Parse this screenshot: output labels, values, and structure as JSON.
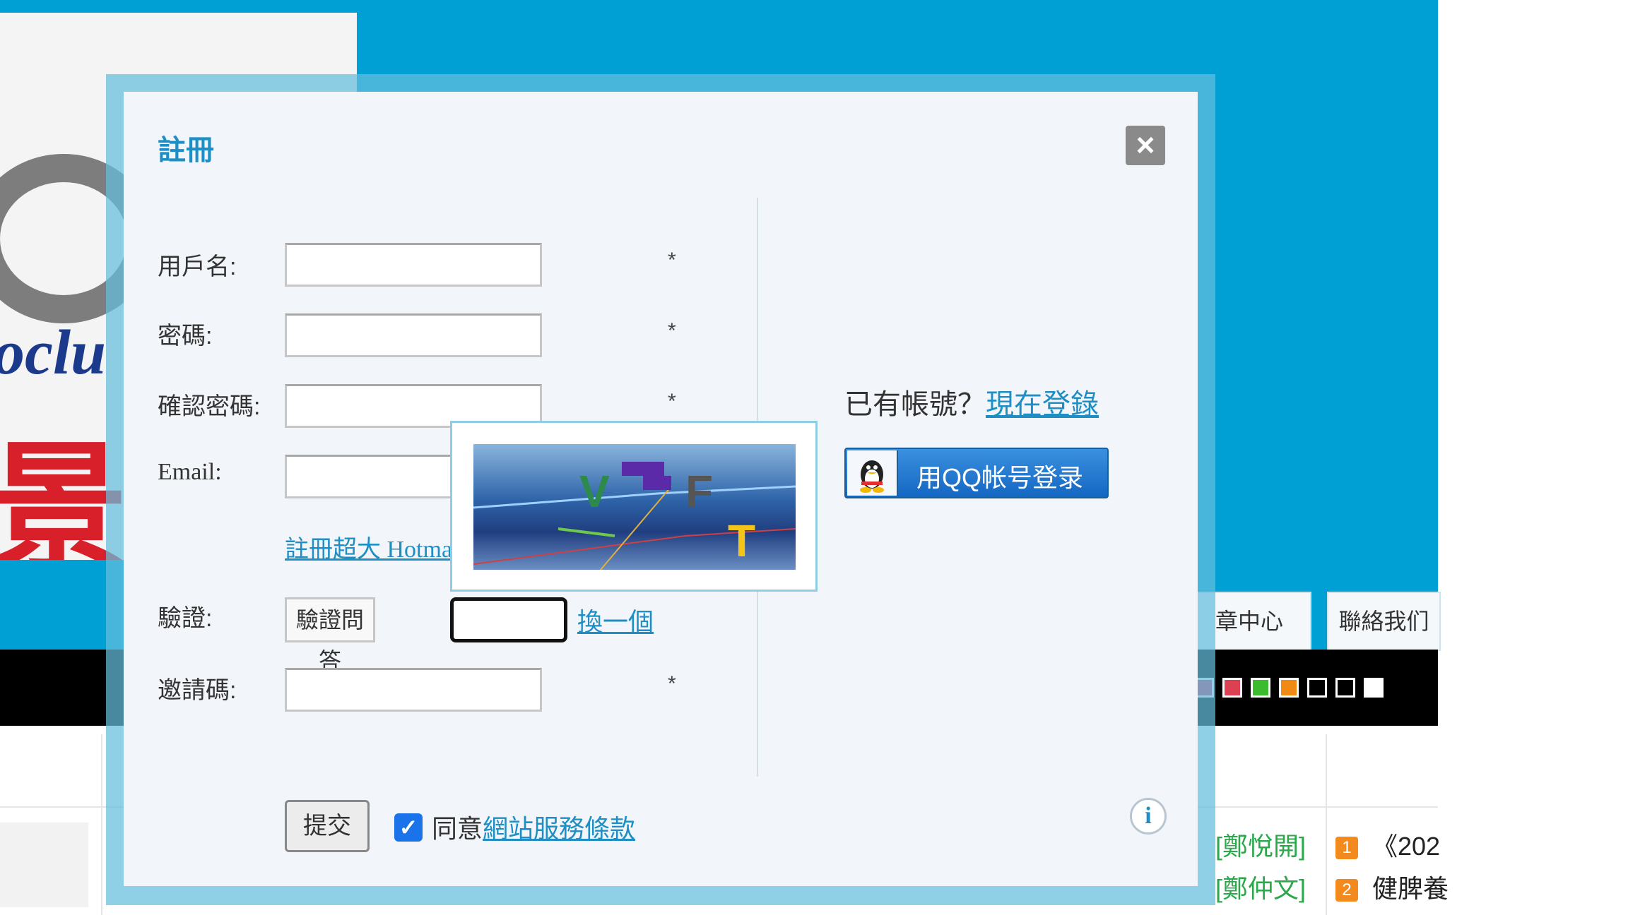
{
  "background": {
    "nav_tabs": [
      "章中心",
      "聯絡我们"
    ],
    "swatch_colors": [
      "#d0335c",
      "#dc4052",
      "#3dbb2e",
      "#f08a14",
      "#000000",
      "#000000",
      "#ffffff"
    ],
    "news": [
      {
        "author": "[鄭悅開]",
        "badge": "1",
        "title": "《202"
      },
      {
        "author": "[鄭仲文]",
        "badge": "2",
        "title": "健脾養"
      }
    ]
  },
  "dialog": {
    "title": "註冊",
    "close_icon": "close-icon",
    "fields": {
      "username_label": "用戶名:",
      "password_label": "密碼:",
      "confirm_label": "確認密碼:",
      "email_label": "Email:",
      "invite_label": "邀請碼:",
      "required_mark": "*"
    },
    "hotmail_link": "註冊超大 Hotmail",
    "captcha": {
      "label": "驗證:",
      "question_button": "驗證問答",
      "refresh_link": "換一個",
      "image_chars": [
        "V",
        "F",
        "T"
      ]
    },
    "submit_label": "提交",
    "agree": {
      "checked": true,
      "prefix": "同意",
      "terms_link": "網站服務條款"
    },
    "info_icon": "i",
    "login": {
      "prompt": "已有帳號？",
      "link": "現在登錄",
      "qq_button": "用QQ帐号登录"
    }
  }
}
